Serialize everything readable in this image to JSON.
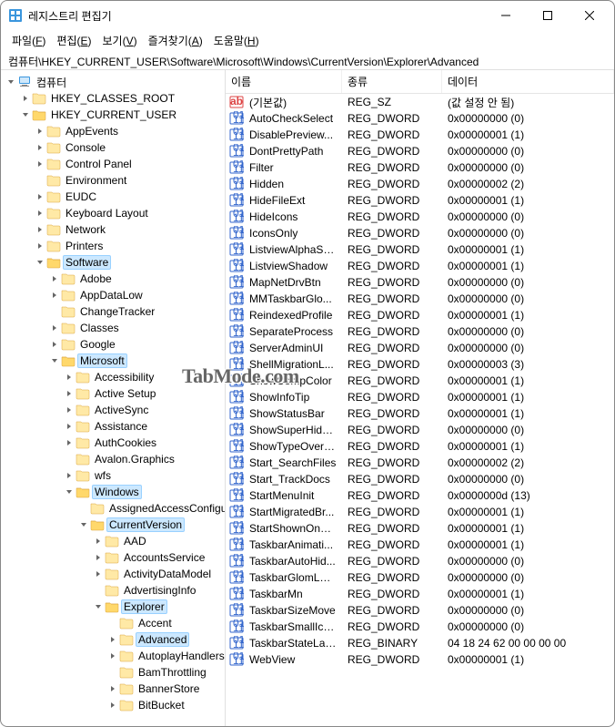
{
  "title": "레지스트리 편집기",
  "menu": [
    {
      "label": "파일",
      "u": "F"
    },
    {
      "label": "편집",
      "u": "E"
    },
    {
      "label": "보기",
      "u": "V"
    },
    {
      "label": "즐겨찾기",
      "u": "A"
    },
    {
      "label": "도움말",
      "u": "H"
    }
  ],
  "path": "컴퓨터\\HKEY_CURRENT_USER\\Software\\Microsoft\\Windows\\CurrentVersion\\Explorer\\Advanced",
  "columns": {
    "name": "이름",
    "type": "종류",
    "data": "데이터"
  },
  "tree": {
    "label": "컴퓨터",
    "expanded": true,
    "pc": true,
    "children": [
      {
        "label": "HKEY_CLASSES_ROOT",
        "leaf": false
      },
      {
        "label": "HKEY_CURRENT_USER",
        "expanded": true,
        "children": [
          {
            "label": "AppEvents",
            "leaf": false
          },
          {
            "label": "Console",
            "leaf": false
          },
          {
            "label": "Control Panel",
            "leaf": false
          },
          {
            "label": "Environment",
            "leaf": true
          },
          {
            "label": "EUDC",
            "leaf": false
          },
          {
            "label": "Keyboard Layout",
            "leaf": false
          },
          {
            "label": "Network",
            "leaf": false
          },
          {
            "label": "Printers",
            "leaf": false
          },
          {
            "label": "Software",
            "expanded": true,
            "sel": true,
            "children": [
              {
                "label": "Adobe",
                "leaf": false
              },
              {
                "label": "AppDataLow",
                "leaf": false
              },
              {
                "label": "ChangeTracker",
                "leaf": true
              },
              {
                "label": "Classes",
                "leaf": false
              },
              {
                "label": "Google",
                "leaf": false
              },
              {
                "label": "Microsoft",
                "expanded": true,
                "sel": true,
                "children": [
                  {
                    "label": "Accessibility",
                    "leaf": false
                  },
                  {
                    "label": "Active Setup",
                    "leaf": false
                  },
                  {
                    "label": "ActiveSync",
                    "leaf": false
                  },
                  {
                    "label": "Assistance",
                    "leaf": false
                  },
                  {
                    "label": "AuthCookies",
                    "leaf": false
                  },
                  {
                    "label": "Avalon.Graphics",
                    "leaf": true
                  },
                  {
                    "label": "wfs",
                    "leaf": false
                  },
                  {
                    "label": "Windows",
                    "expanded": true,
                    "sel": true,
                    "children": [
                      {
                        "label": "AssignedAccessConfiguration",
                        "leaf": true
                      },
                      {
                        "label": "CurrentVersion",
                        "expanded": true,
                        "sel": true,
                        "children": [
                          {
                            "label": "AAD",
                            "leaf": false
                          },
                          {
                            "label": "AccountsService",
                            "leaf": false
                          },
                          {
                            "label": "ActivityDataModel",
                            "leaf": false
                          },
                          {
                            "label": "AdvertisingInfo",
                            "leaf": true
                          },
                          {
                            "label": "Explorer",
                            "expanded": true,
                            "sel": true,
                            "children": [
                              {
                                "label": "Accent",
                                "leaf": true
                              },
                              {
                                "label": "Advanced",
                                "sel": true,
                                "leaf": false
                              },
                              {
                                "label": "AutoplayHandlers",
                                "leaf": false
                              },
                              {
                                "label": "BamThrottling",
                                "leaf": true
                              },
                              {
                                "label": "BannerStore",
                                "leaf": false
                              },
                              {
                                "label": "BitBucket",
                                "leaf": false
                              }
                            ]
                          }
                        ]
                      }
                    ]
                  }
                ]
              }
            ]
          }
        ]
      }
    ]
  },
  "values": [
    {
      "name": "(기본값)",
      "type": "REG_SZ",
      "data": "(값 설정 안 됨)",
      "icon": "str"
    },
    {
      "name": "AutoCheckSelect",
      "type": "REG_DWORD",
      "data": "0x00000000 (0)",
      "icon": "bin"
    },
    {
      "name": "DisablePreview...",
      "type": "REG_DWORD",
      "data": "0x00000001 (1)",
      "icon": "bin"
    },
    {
      "name": "DontPrettyPath",
      "type": "REG_DWORD",
      "data": "0x00000000 (0)",
      "icon": "bin"
    },
    {
      "name": "Filter",
      "type": "REG_DWORD",
      "data": "0x00000000 (0)",
      "icon": "bin"
    },
    {
      "name": "Hidden",
      "type": "REG_DWORD",
      "data": "0x00000002 (2)",
      "icon": "bin"
    },
    {
      "name": "HideFileExt",
      "type": "REG_DWORD",
      "data": "0x00000001 (1)",
      "icon": "bin"
    },
    {
      "name": "HideIcons",
      "type": "REG_DWORD",
      "data": "0x00000000 (0)",
      "icon": "bin"
    },
    {
      "name": "IconsOnly",
      "type": "REG_DWORD",
      "data": "0x00000000 (0)",
      "icon": "bin"
    },
    {
      "name": "ListviewAlphaSe...",
      "type": "REG_DWORD",
      "data": "0x00000001 (1)",
      "icon": "bin"
    },
    {
      "name": "ListviewShadow",
      "type": "REG_DWORD",
      "data": "0x00000001 (1)",
      "icon": "bin"
    },
    {
      "name": "MapNetDrvBtn",
      "type": "REG_DWORD",
      "data": "0x00000000 (0)",
      "icon": "bin"
    },
    {
      "name": "MMTaskbarGlo...",
      "type": "REG_DWORD",
      "data": "0x00000000 (0)",
      "icon": "bin"
    },
    {
      "name": "ReindexedProfile",
      "type": "REG_DWORD",
      "data": "0x00000001 (1)",
      "icon": "bin"
    },
    {
      "name": "SeparateProcess",
      "type": "REG_DWORD",
      "data": "0x00000000 (0)",
      "icon": "bin"
    },
    {
      "name": "ServerAdminUI",
      "type": "REG_DWORD",
      "data": "0x00000000 (0)",
      "icon": "bin"
    },
    {
      "name": "ShellMigrationL...",
      "type": "REG_DWORD",
      "data": "0x00000003 (3)",
      "icon": "bin"
    },
    {
      "name": "ShowCompColor",
      "type": "REG_DWORD",
      "data": "0x00000001 (1)",
      "icon": "bin"
    },
    {
      "name": "ShowInfoTip",
      "type": "REG_DWORD",
      "data": "0x00000001 (1)",
      "icon": "bin"
    },
    {
      "name": "ShowStatusBar",
      "type": "REG_DWORD",
      "data": "0x00000001 (1)",
      "icon": "bin"
    },
    {
      "name": "ShowSuperHidd...",
      "type": "REG_DWORD",
      "data": "0x00000000 (0)",
      "icon": "bin"
    },
    {
      "name": "ShowTypeOverlay",
      "type": "REG_DWORD",
      "data": "0x00000001 (1)",
      "icon": "bin"
    },
    {
      "name": "Start_SearchFiles",
      "type": "REG_DWORD",
      "data": "0x00000002 (2)",
      "icon": "bin"
    },
    {
      "name": "Start_TrackDocs",
      "type": "REG_DWORD",
      "data": "0x00000000 (0)",
      "icon": "bin"
    },
    {
      "name": "StartMenuInit",
      "type": "REG_DWORD",
      "data": "0x0000000d (13)",
      "icon": "bin"
    },
    {
      "name": "StartMigratedBr...",
      "type": "REG_DWORD",
      "data": "0x00000001 (1)",
      "icon": "bin"
    },
    {
      "name": "StartShownOnU...",
      "type": "REG_DWORD",
      "data": "0x00000001 (1)",
      "icon": "bin"
    },
    {
      "name": "TaskbarAnimati...",
      "type": "REG_DWORD",
      "data": "0x00000001 (1)",
      "icon": "bin"
    },
    {
      "name": "TaskbarAutoHid...",
      "type": "REG_DWORD",
      "data": "0x00000000 (0)",
      "icon": "bin"
    },
    {
      "name": "TaskbarGlomLevel",
      "type": "REG_DWORD",
      "data": "0x00000000 (0)",
      "icon": "bin"
    },
    {
      "name": "TaskbarMn",
      "type": "REG_DWORD",
      "data": "0x00000001 (1)",
      "icon": "bin"
    },
    {
      "name": "TaskbarSizeMove",
      "type": "REG_DWORD",
      "data": "0x00000000 (0)",
      "icon": "bin"
    },
    {
      "name": "TaskbarSmallIco...",
      "type": "REG_DWORD",
      "data": "0x00000000 (0)",
      "icon": "bin"
    },
    {
      "name": "TaskbarStateLas...",
      "type": "REG_BINARY",
      "data": "04 18 24 62 00 00 00 00",
      "icon": "bin"
    },
    {
      "name": "WebView",
      "type": "REG_DWORD",
      "data": "0x00000001 (1)",
      "icon": "bin"
    }
  ],
  "watermark": "TabMode.com"
}
